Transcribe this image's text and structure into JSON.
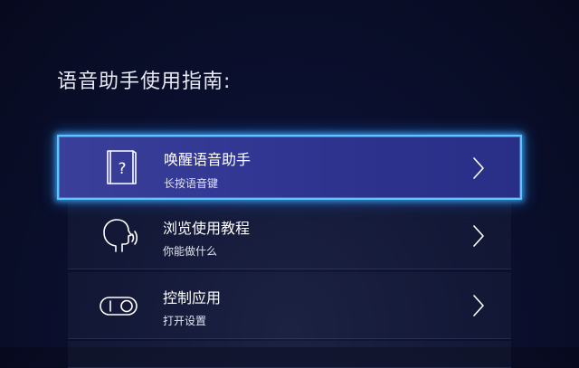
{
  "page": {
    "title": "语音助手使用指南:"
  },
  "menu": {
    "items": [
      {
        "title": "唤醒语音助手",
        "subtitle": "长按语音键",
        "icon": "book-question-icon",
        "focused": true
      },
      {
        "title": "浏览使用教程",
        "subtitle": "你能做什么",
        "icon": "speaking-head-icon",
        "focused": false
      },
      {
        "title": "控制应用",
        "subtitle": "打开设置",
        "icon": "toggle-switch-icon",
        "focused": false
      }
    ]
  },
  "colors": {
    "background": "#0b1030",
    "focus_fill": "#2f3590",
    "focus_border": "#5ec6ff",
    "text": "#ffffff"
  }
}
